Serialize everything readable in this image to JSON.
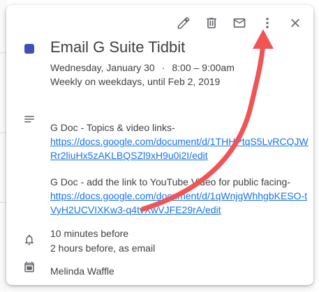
{
  "toolbar": {
    "edit_icon": "pencil-icon",
    "delete_icon": "trash-icon",
    "email_icon": "mail-icon",
    "more_icon": "more-vert-icon",
    "close_icon": "close-icon"
  },
  "event": {
    "color": "#3f51b5",
    "title": "Email G Suite Tidbit",
    "date": "Wednesday, January 30",
    "separator": "·",
    "time": "8:00 – 9:00am",
    "recurrence": "Weekly on weekdays, until Feb 2, 2019"
  },
  "description": {
    "line1": "G Doc - Topics & video links-",
    "link1": "https://docs.google.com/document/d/1THHPtqS5LvRCQJWRr2liuHx5zAKLBQSZl9xH9u0i2I/edit",
    "line2": "G Doc - add the link to YouTube Video for public facing-",
    "link2": "https://docs.google.com/document/d/1qWnjgWhhgbKESO-tVyH2UCVIXKw3-q4tvXwVJFE29rA/edit"
  },
  "notifications": {
    "first": "10 minutes before",
    "second": "2 hours before, as email"
  },
  "organizer": {
    "name": "Melinda Waffle"
  },
  "annotation": {
    "arrow_color": "#f05454"
  }
}
